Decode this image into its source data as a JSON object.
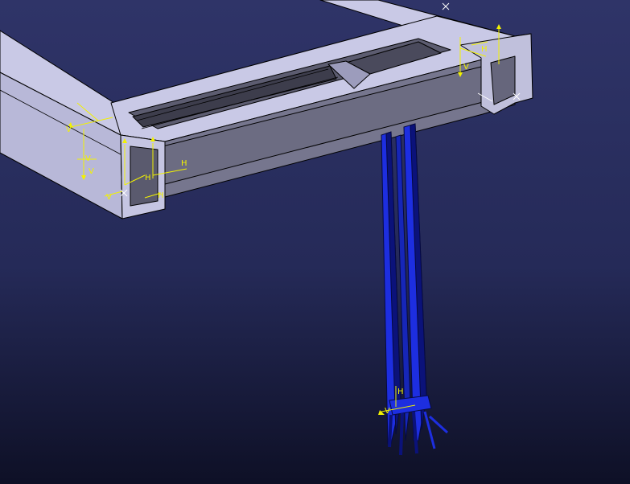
{
  "viewport": {
    "background_top": "#2f3468",
    "background_bottom": "#0e1026"
  },
  "colors": {
    "frame_top": "#c9c9e6",
    "frame_side": "#8a8aa6",
    "frame_front": "#6f6f86",
    "frame_edge": "#000000",
    "slot_dark": "#3d3d4c",
    "post_blue": "#1d2ee0",
    "post_blue_dark": "#0b127a",
    "constraint_yellow": "#f2f200"
  },
  "constraint_labels": {
    "h1": "H",
    "h2": "H",
    "h3": "H",
    "v1": "V",
    "v2": "V",
    "v3": "V",
    "v4": "V",
    "h4": "H",
    "v5": "V",
    "h5": "H",
    "v6": "V"
  }
}
